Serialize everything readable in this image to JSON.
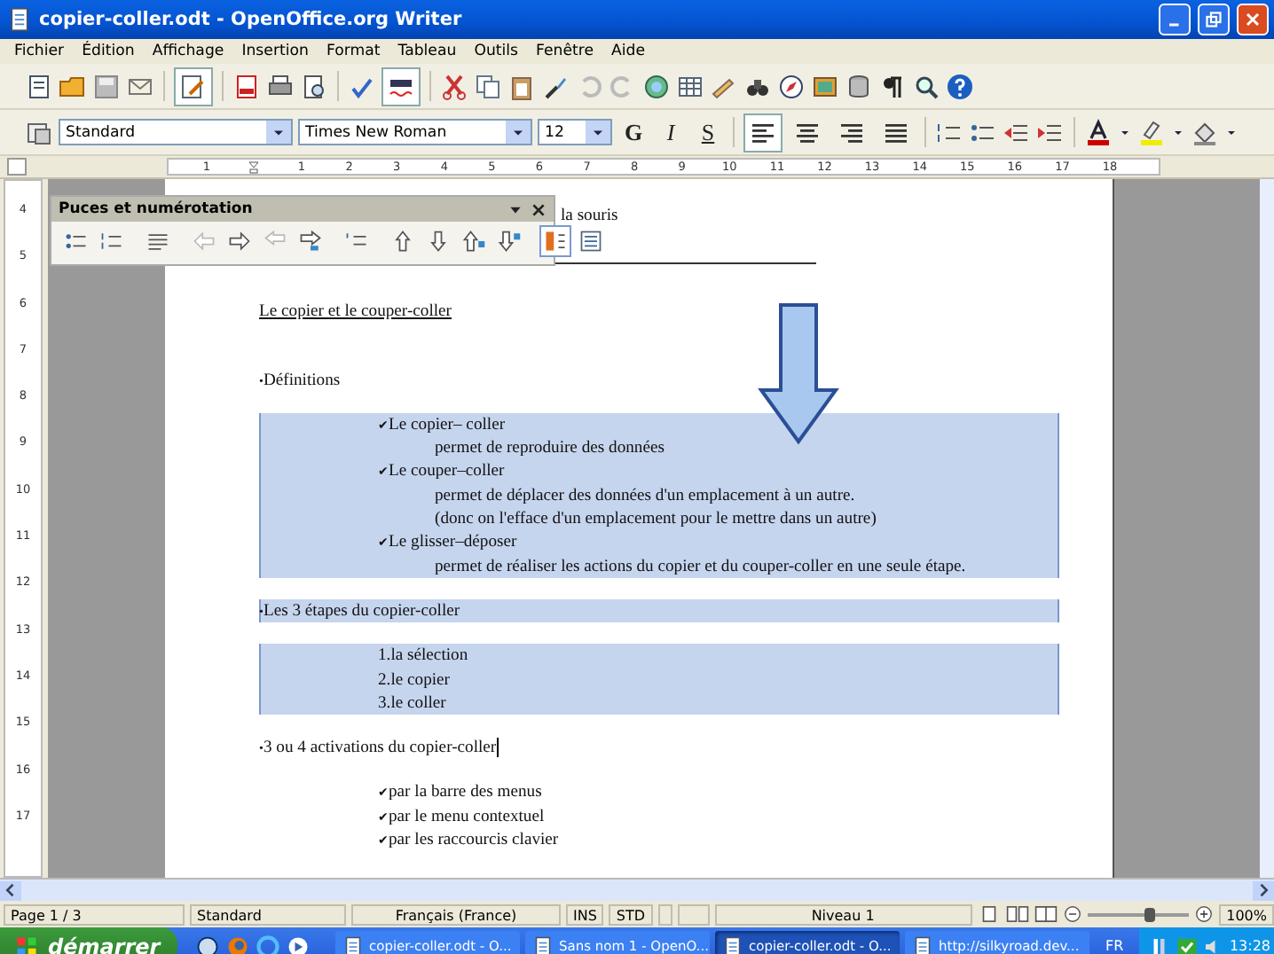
{
  "window": {
    "title": "copier-coller.odt - OpenOffice.org Writer"
  },
  "menu": [
    "Fichier",
    "Édition",
    "Affichage",
    "Insertion",
    "Format",
    "Tableau",
    "Outils",
    "Fenêtre",
    "Aide"
  ],
  "standard_toolbar": {
    "edit_mode_on": true,
    "auto_spellcheck_on": true
  },
  "format_toolbar": {
    "style": "Standard",
    "font": "Times New Roman",
    "size": "12",
    "bold": "G",
    "italic": "I",
    "underline": "S",
    "alignment": [
      {
        "kind": "left",
        "selected": true
      },
      {
        "kind": "center",
        "selected": false
      },
      {
        "kind": "right",
        "selected": false
      },
      {
        "kind": "justify",
        "selected": false
      }
    ]
  },
  "ruler": {
    "horizontal": [
      "1",
      "1",
      "2",
      "3",
      "4",
      "5",
      "6",
      "7",
      "8",
      "9",
      "10",
      "11",
      "12",
      "13",
      "14",
      "15",
      "16",
      "17",
      "18"
    ],
    "vertical": [
      "4",
      "5",
      "6",
      "7",
      "8",
      "9",
      "10",
      "11",
      "12",
      "13",
      "14",
      "15",
      "16",
      "17"
    ]
  },
  "floating_toolbar": {
    "title": "Puces et numérotation",
    "buttons": [
      {
        "kind": "bullets",
        "selected": false
      },
      {
        "kind": "numbering",
        "selected": false
      },
      {
        "kind": "off",
        "selected": false
      },
      {
        "kind": "demote",
        "selected": false
      },
      {
        "kind": "promote",
        "selected": false
      },
      {
        "kind": "demote-sub",
        "selected": false
      },
      {
        "kind": "promote-sub",
        "selected": false
      },
      {
        "kind": "unnumbered",
        "selected": false
      },
      {
        "kind": "up",
        "selected": false
      },
      {
        "kind": "down",
        "selected": false
      },
      {
        "kind": "up-sub",
        "selected": false
      },
      {
        "kind": "down-sub",
        "selected": false
      },
      {
        "kind": "restart",
        "selected": true
      },
      {
        "kind": "dialog",
        "selected": false
      }
    ]
  },
  "document": {
    "lines": [
      {
        "kind": "partial",
        "text": "la souris",
        "selected": false
      },
      {
        "kind": "rule"
      },
      {
        "kind": "heading",
        "text": "Le copier et le couper-coller",
        "selected": false
      },
      {
        "kind": "bullet",
        "marker": "•",
        "text": "Définitions",
        "selected": false
      },
      {
        "kind": "check",
        "marker": "✔",
        "text": "Le copier– coller",
        "selected": true
      },
      {
        "kind": "body",
        "text": "permet de reproduire des données",
        "selected": true
      },
      {
        "kind": "check",
        "marker": "✔",
        "text": "Le couper–coller",
        "selected": true
      },
      {
        "kind": "body",
        "text": "permet de déplacer des données d'un emplacement à un autre.",
        "selected": true
      },
      {
        "kind": "body",
        "text": "(donc on l'efface d'un emplacement pour le mettre dans un autre)",
        "selected": true
      },
      {
        "kind": "check",
        "marker": "✔",
        "text": "Le glisser–déposer",
        "selected": true
      },
      {
        "kind": "body",
        "text": "permet de réaliser les actions du copier et du couper-coller en une seule étape.",
        "selected": true
      },
      {
        "kind": "bullet",
        "marker": "•",
        "text": "Les 3 étapes du copier-coller",
        "selected": true
      },
      {
        "kind": "number",
        "text": "1.la sélection",
        "selected": true
      },
      {
        "kind": "number",
        "text": "2.le copier",
        "selected": true
      },
      {
        "kind": "number",
        "text": "3.le coller",
        "selected": true
      },
      {
        "kind": "bullet",
        "marker": "•",
        "text": "3 ou 4 activations du copier-coller",
        "selected": false
      },
      {
        "kind": "check",
        "marker": "✔",
        "text": "par la barre des menus",
        "selected": false
      },
      {
        "kind": "check",
        "marker": "✔",
        "text": "par le menu contextuel",
        "selected": false
      },
      {
        "kind": "check",
        "marker": "✔",
        "text": "par les raccourcis clavier",
        "selected": false
      }
    ]
  },
  "status_bar": {
    "page": "Page 1 / 3",
    "style": "Standard",
    "language": "Français (France)",
    "insert_mode": "INS",
    "selection_mode": "STD",
    "outline_level": "Niveau 1",
    "zoom": {
      "level": 0.62
    },
    "zoom_percent": "100%"
  },
  "taskbar": {
    "start": "démarrer",
    "tasks": [
      {
        "label": "copier-coller.odt - O...",
        "selected": false
      },
      {
        "label": "Sans nom 1 - OpenO...",
        "selected": false
      },
      {
        "label": "copier-coller.odt - O...",
        "selected": true
      },
      {
        "label": "http://silkyroad.dev...",
        "selected": false
      }
    ],
    "language": "FR",
    "clock": "13:28"
  }
}
